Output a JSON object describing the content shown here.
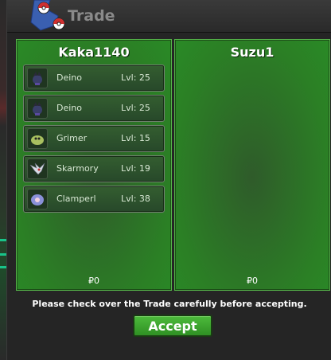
{
  "window": {
    "title": "Trade"
  },
  "left_panel": {
    "player_name": "Kaka1140",
    "money": "₽0",
    "pokemon": [
      {
        "name": "Deino",
        "level": "Lvl: 25",
        "icon": "deino-icon"
      },
      {
        "name": "Deino",
        "level": "Lvl: 25",
        "icon": "deino-icon"
      },
      {
        "name": "Grimer",
        "level": "Lvl: 15",
        "icon": "grimer-icon"
      },
      {
        "name": "Skarmory",
        "level": "Lvl: 19",
        "icon": "skarmory-icon"
      },
      {
        "name": "Clamperl",
        "level": "Lvl: 38",
        "icon": "clamperl-icon"
      }
    ]
  },
  "right_panel": {
    "player_name": "Suzu1",
    "money": "₽0",
    "pokemon": []
  },
  "footer": {
    "notice": "Please check over the Trade carefully before accepting.",
    "accept_label": "Accept"
  },
  "colors": {
    "panel_green": "#2b7f25",
    "button_green": "#3aa12e",
    "window_bg": "#252525"
  }
}
